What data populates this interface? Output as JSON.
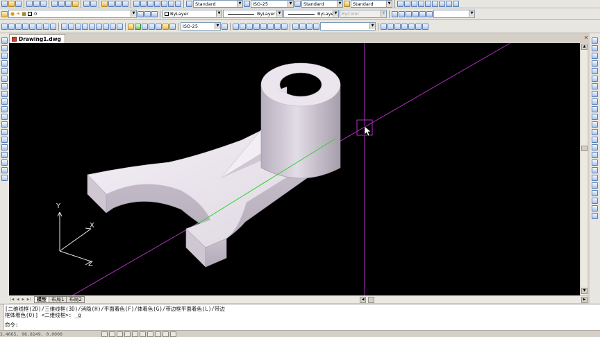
{
  "toolbar1": {
    "text_style": "Standard",
    "dim_style": "ISO-25",
    "table_style": "Standard",
    "mleader_style": "Standard"
  },
  "toolbar2": {
    "layer": "0",
    "color": "ByLayer",
    "linetype": "ByLayer",
    "lineweight": "ByLayer",
    "plotstyle": "ByColor"
  },
  "toolbar3": {
    "dim_style": "ISO-25"
  },
  "document": {
    "tab_title": "Drawing1.dwg"
  },
  "layout_tabs": [
    "模型",
    "布局1",
    "布局2"
  ],
  "command": {
    "line1": "[二维线框(2D)/三维线框(3D)/消隐(H)/平面着色(F)/体着色(G)/带边框平面着色(L)/带边",
    "line2": "框体着色(O)] <二维线框>: _g",
    "prompt": "命令:"
  },
  "status": {
    "coords": "53.4065, 96.8149, 0.0000"
  },
  "ucs": {
    "x_label": "X",
    "y_label": "Y",
    "z_label": "Z"
  },
  "colors": {
    "viewport_bg": "#000000",
    "crosshair": "#b030c0",
    "model_face": "#d8d2dc",
    "model_edge": "#a49cab",
    "green_line": "#2fd02f"
  }
}
